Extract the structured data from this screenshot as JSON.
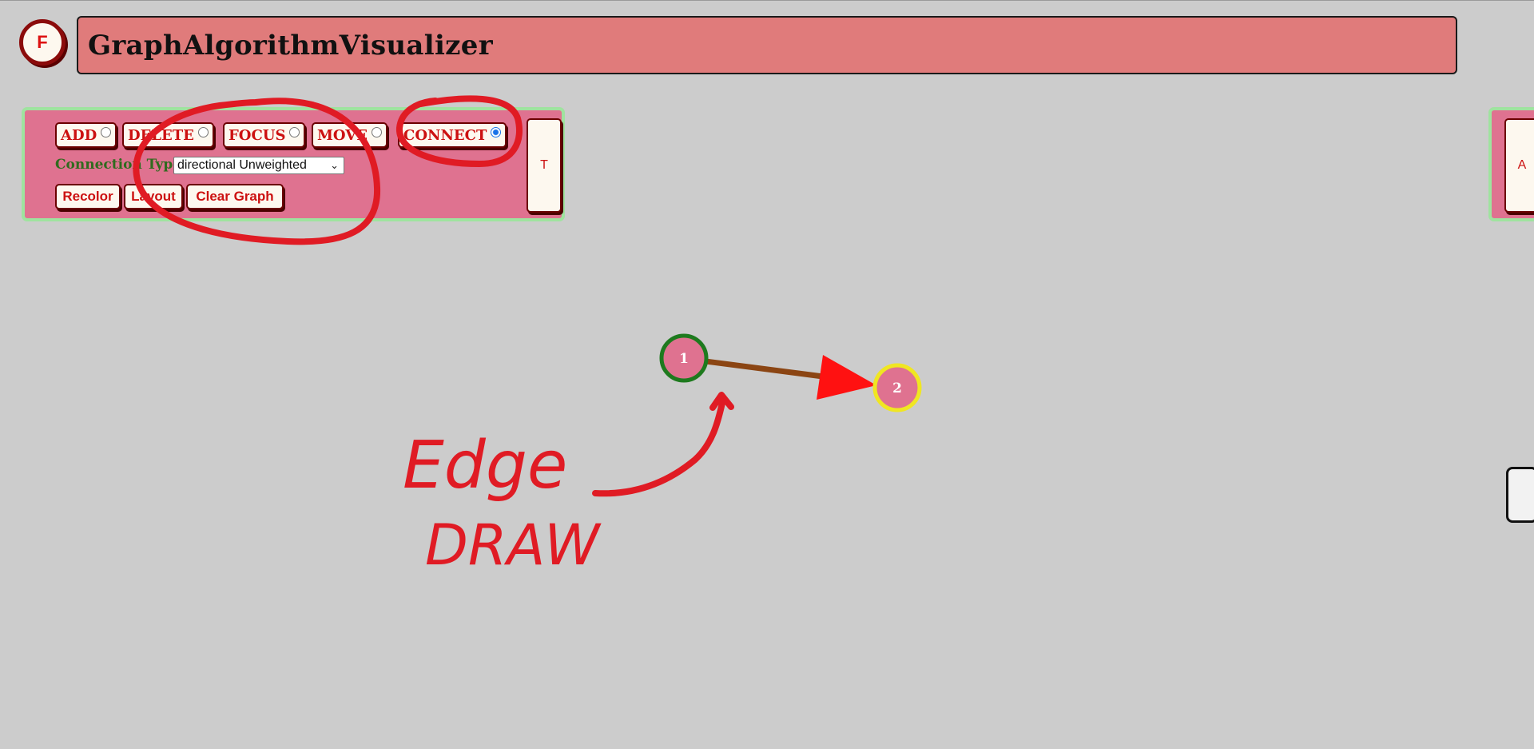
{
  "app": {
    "logo_label": "F",
    "title": "GraphAlgorithmVisualizer"
  },
  "toolbar": {
    "modes": [
      {
        "label": "ADD",
        "checked": false
      },
      {
        "label": "DELETE",
        "checked": false
      },
      {
        "label": "FOCUS",
        "checked": false
      },
      {
        "label": "MOVE",
        "checked": false
      },
      {
        "label": "CONNECT",
        "checked": true
      }
    ],
    "connection_label": "Connection Type",
    "connection_value": "directional Unweighted",
    "actions": {
      "recolor": "Recolor",
      "layout": "Layout",
      "clear": "Clear Graph"
    },
    "side_toggle": "T",
    "right_toggle": "A"
  },
  "graph": {
    "nodes": [
      {
        "id": "1",
        "label": "1",
        "border": "#1e7a1e",
        "fill": "#df7290"
      },
      {
        "id": "2",
        "label": "2",
        "border": "#f0e622",
        "fill": "#df7290"
      }
    ],
    "edges": [
      {
        "from": "1",
        "to": "2",
        "color": "#8b4513",
        "arrow_color": "#ff1111",
        "directed": true
      }
    ]
  },
  "annotation": {
    "color": "#e01b24",
    "line1": "Edge",
    "line2": "DRAW"
  },
  "colors": {
    "background": "#cccccc",
    "title_bar": "#e07b7b",
    "panel": "#df7290",
    "panel_border": "#9fe39f",
    "button_text": "#cc1111"
  }
}
